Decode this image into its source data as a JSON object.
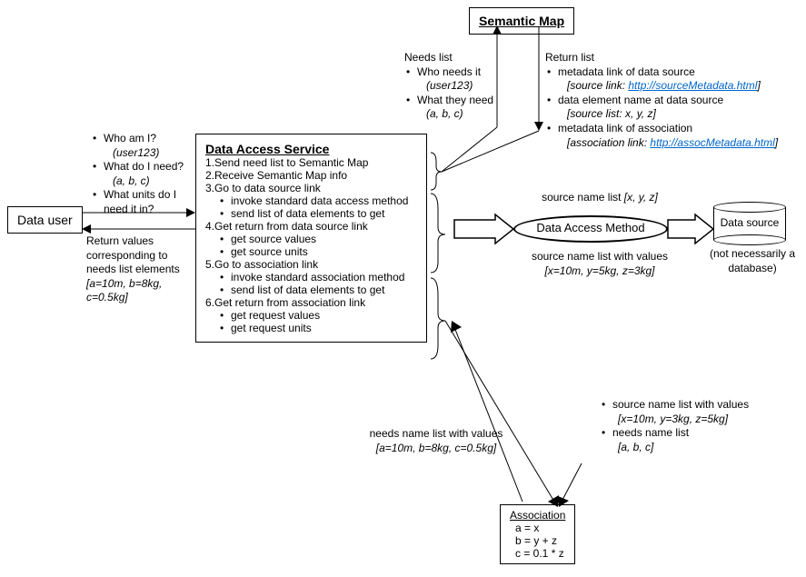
{
  "semantic_map": {
    "title": "Semantic Map"
  },
  "data_user": {
    "title": "Data user"
  },
  "data_access_service": {
    "title": "Data Access Service",
    "step1": "1.Send need list to Semantic Map",
    "step2": "2.Receive Semantic Map info",
    "step3": "3.Go to data source link",
    "step3a": "invoke standard data access method",
    "step3b": "send list of data elements to get",
    "step4": "4.Get return from data source link",
    "step4a": "get source values",
    "step4b": "get source units",
    "step5": "5.Go to association link",
    "step5a": "invoke standard association method",
    "step5b": "send list of data elements to get",
    "step6": "6.Get return from association link",
    "step6a": "get request values",
    "step6b": "get request units"
  },
  "data_access_method": {
    "title": "Data Access Method"
  },
  "data_source": {
    "title": "Data source",
    "note": "(not necessarily a database)"
  },
  "association": {
    "title": "Association",
    "r1": "a = x",
    "r2": "b = y + z",
    "r3": "c = 0.1 * z"
  },
  "user_questions": {
    "q1": "Who am I?",
    "q1a": "(user123)",
    "q2": "What do I need?",
    "q2a": "(a, b, c)",
    "q3": "What units do I need it in?"
  },
  "return_values": {
    "label": "Return values corresponding to needs list elements",
    "val": "[a=10m, b=8kg, c=0.5kg]"
  },
  "needs_list": {
    "title": "Needs list",
    "b1": "Who needs it",
    "b1a": "(user123)",
    "b2": "What they need",
    "b2a": "(a, b, c)"
  },
  "return_list": {
    "title": "Return list",
    "b1": "metadata link of data source",
    "b1a_prefix": "[source link: ",
    "b1a_link": "http://sourceMetadata.html",
    "b1a_suffix": "]",
    "b2": "data element name at data source",
    "b2a": "[source list: x, y, z]",
    "b3": "metadata link of association",
    "b3a_prefix": "[association link: ",
    "b3a_link": "http://assocMetadata.html",
    "b3a_suffix": "]"
  },
  "dam_top": {
    "label": "source name list ",
    "val": "[x, y, z]"
  },
  "dam_bottom": {
    "label": "source name list with values",
    "val": "[x=10m, y=5kg, z=3kg]"
  },
  "assoc_left": {
    "label": "needs name list with values",
    "val": "[a=10m, b=8kg, c=0.5kg]"
  },
  "assoc_right": {
    "b1": "source name list with values",
    "b1a": "[x=10m, y=3kg, z=5kg]",
    "b2": "needs name list",
    "b2a": "[a, b, c]"
  }
}
